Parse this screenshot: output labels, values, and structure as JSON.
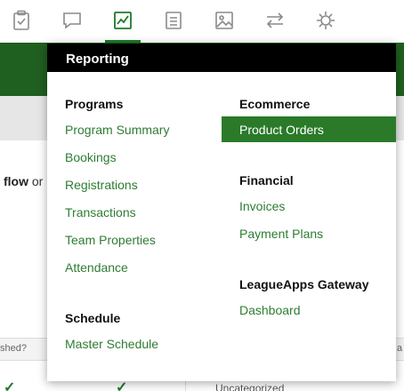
{
  "menu": {
    "header": "Reporting",
    "programs": {
      "title": "Programs",
      "items": [
        "Program Summary",
        "Bookings",
        "Registrations",
        "Transactions",
        "Team Properties",
        "Attendance"
      ]
    },
    "schedule": {
      "title": "Schedule",
      "items": [
        "Master Schedule"
      ]
    },
    "ecommerce": {
      "title": "Ecommerce",
      "items": [
        "Product Orders"
      ]
    },
    "financial": {
      "title": "Financial",
      "items": [
        "Invoices",
        "Payment Plans"
      ]
    },
    "gateway": {
      "title": "LeagueApps Gateway",
      "items": [
        "Dashboard"
      ]
    }
  },
  "background": {
    "text_bold": "flow",
    "text_rest": " or",
    "column_header_left": "shed?",
    "column_header_right": "a",
    "category_value": "Uncategorized"
  },
  "colors": {
    "accent": "#2a7a2a",
    "link": "#2e7d32",
    "header_bg": "#000000"
  }
}
